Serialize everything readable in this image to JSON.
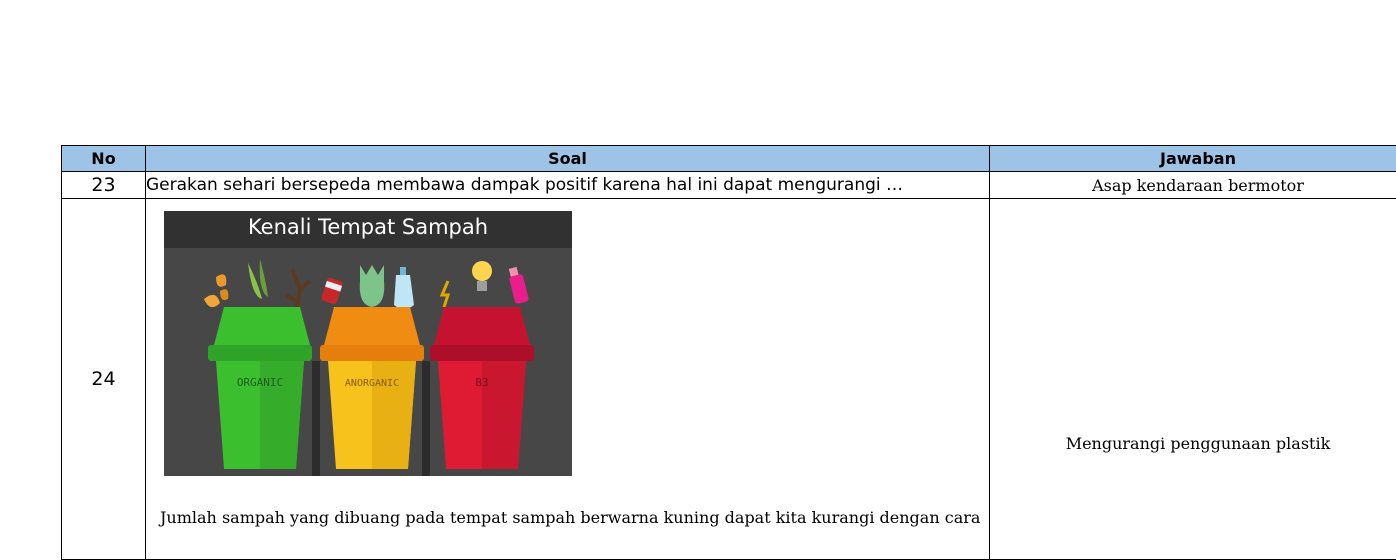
{
  "table": {
    "headers": {
      "no": "No",
      "soal": "Soal",
      "jawaban": "Jawaban"
    },
    "rows": [
      {
        "no": "23",
        "soal": "Gerakan sehari bersepeda membawa dampak positif karena hal ini dapat mengurangi …",
        "jawaban": "Asap kendaraan bermotor"
      },
      {
        "no": "24",
        "image": {
          "title": "Kenali Tempat Sampah",
          "bins": [
            {
              "label": "ORGANIC",
              "color": "#3cbf2f"
            },
            {
              "label": "ANORGANIC",
              "color": "#f7c21b"
            },
            {
              "label": "B3",
              "color": "#df1b34"
            }
          ]
        },
        "soal": "Jumlah sampah yang dibuang pada tempat sampah berwarna kuning dapat kita kurangi dengan cara",
        "jawaban": "Mengurangi penggunaan plastik"
      }
    ]
  }
}
